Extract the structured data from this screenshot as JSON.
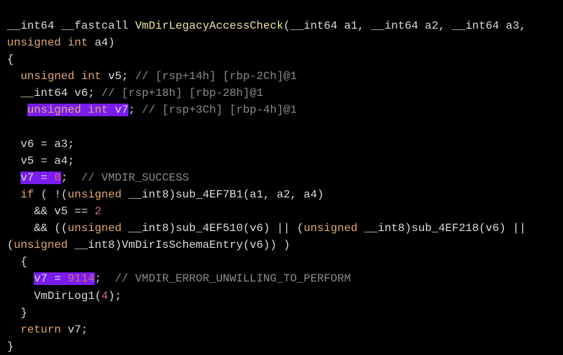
{
  "colors": {
    "background": "#000000",
    "highlight": "#7a1cf0",
    "keyword": "#e0a870",
    "function": "#ece3a8",
    "comment": "#8a8a8a",
    "number": "#d06a78"
  },
  "lines": [
    [
      {
        "t": "__int64 __fastcall "
      },
      {
        "t": "VmDirLegacyAccessCheck",
        "c": "f"
      },
      {
        "t": "(__int64 a1, __int64 a2, __int64 a3,"
      }
    ],
    [
      {
        "t": "unsigned int",
        "c": "k"
      },
      {
        "t": " a4)"
      }
    ],
    [
      {
        "t": "{"
      }
    ],
    [
      {
        "t": "  "
      },
      {
        "t": "unsigned int",
        "c": "k"
      },
      {
        "t": " v5; "
      },
      {
        "t": "// [rsp+14h] [rbp-2Ch]@1",
        "c": "c"
      }
    ],
    [
      {
        "t": "  __int64 v6; "
      },
      {
        "t": "// [rsp+18h] [rbp-28h]@1",
        "c": "c"
      }
    ],
    [
      {
        "t": "   "
      },
      {
        "t": "unsigned int",
        "c": "k",
        "hl": true
      },
      {
        "t": " v7",
        "hl": true
      },
      {
        "t": "; "
      },
      {
        "t": "// [rsp+3Ch] [rbp-4h]@1",
        "c": "c"
      }
    ],
    [
      {
        "t": ""
      }
    ],
    [
      {
        "t": "  v6 = a3;"
      }
    ],
    [
      {
        "t": "  v5 = a4;"
      }
    ],
    [
      {
        "t": "  "
      },
      {
        "t": "v7 = ",
        "hl": true
      },
      {
        "t": "0",
        "c": "n",
        "hl": true
      },
      {
        "t": ";  "
      },
      {
        "t": "// VMDIR_SUCCESS",
        "c": "c"
      }
    ],
    [
      {
        "t": "  "
      },
      {
        "t": "if",
        "c": "k"
      },
      {
        "t": " ( !("
      },
      {
        "t": "unsigned",
        "c": "k"
      },
      {
        "t": " __int8)sub_4EF7B1(a1, a2, a4)"
      }
    ],
    [
      {
        "t": "    && v5 == "
      },
      {
        "t": "2",
        "c": "n"
      }
    ],
    [
      {
        "t": "    && (("
      },
      {
        "t": "unsigned",
        "c": "k"
      },
      {
        "t": " __int8)sub_4EF510(v6) || ("
      },
      {
        "t": "unsigned",
        "c": "k"
      },
      {
        "t": " __int8)sub_4EF218(v6) ||"
      }
    ],
    [
      {
        "t": "("
      },
      {
        "t": "unsigned",
        "c": "k"
      },
      {
        "t": " __int8)VmDirIsSchemaEntry(v6)) )"
      }
    ],
    [
      {
        "t": "  {"
      }
    ],
    [
      {
        "t": "    "
      },
      {
        "t": "v7 = ",
        "hl": true
      },
      {
        "t": "9114",
        "c": "n",
        "hl": true
      },
      {
        "t": ";  "
      },
      {
        "t": "// VMDIR_ERROR_UNWILLING_TO_PERFORM",
        "c": "c"
      }
    ],
    [
      {
        "t": "    VmDirLog1("
      },
      {
        "t": "4",
        "c": "n"
      },
      {
        "t": ");"
      }
    ],
    [
      {
        "t": "  }"
      }
    ],
    [
      {
        "t": "  "
      },
      {
        "t": "return",
        "c": "k"
      },
      {
        "t": " v7;"
      }
    ],
    [
      {
        "t": "}"
      }
    ]
  ]
}
